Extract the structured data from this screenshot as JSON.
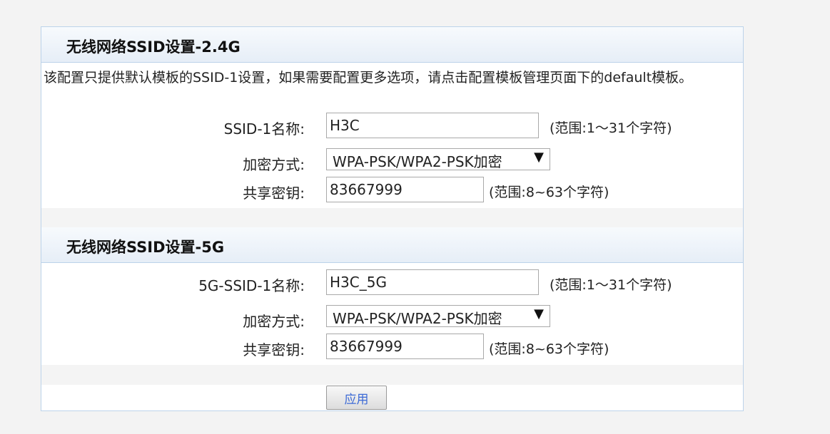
{
  "section_24g": {
    "title": "无线网络SSID设置-2.4G",
    "note": "该配置只提供默认模板的SSID-1设置，如果需要配置更多选项，请点击配置模板管理页面下的default模板。",
    "ssid_label": "SSID-1名称:",
    "ssid_value": "H3C",
    "ssid_hint": "(范围:1～31个字符)",
    "encryption_label": "加密方式:",
    "encryption_value": "WPA-PSK/WPA2-PSK加密",
    "key_label": "共享密钥:",
    "key_value": "83667999",
    "key_hint": "(范围:8~63个字符)"
  },
  "section_5g": {
    "title": "无线网络SSID设置-5G",
    "ssid_label": "5G-SSID-1名称:",
    "ssid_value": "H3C_5G",
    "ssid_hint": "(范围:1～31个字符)",
    "encryption_label": "加密方式:",
    "encryption_value": "WPA-PSK/WPA2-PSK加密",
    "key_label": "共享密钥:",
    "key_value": "83667999",
    "key_hint": "(范围:8~63个字符)"
  },
  "apply_label": "应用",
  "icons": {
    "dropdown": "chevron-down-icon"
  }
}
